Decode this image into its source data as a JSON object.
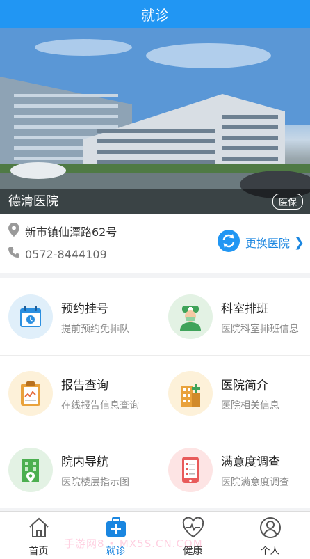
{
  "header": {
    "title": "就诊"
  },
  "hospital": {
    "name": "德清医院",
    "badge": "医保"
  },
  "info": {
    "address": "新市镇仙潭路62号",
    "phone": "0572-8444109",
    "switch_label": "更换医院"
  },
  "services": [
    {
      "title": "预约挂号",
      "subtitle": "提前预约免排队",
      "icon": "calendar-icon"
    },
    {
      "title": "科室排班",
      "subtitle": "医院科室排班信息",
      "icon": "doctor-icon"
    },
    {
      "title": "报告查询",
      "subtitle": "在线报告信息查询",
      "icon": "report-clipboard-icon"
    },
    {
      "title": "医院简介",
      "subtitle": "医院相关信息",
      "icon": "hospital-building-icon"
    },
    {
      "title": "院内导航",
      "subtitle": "医院楼层指示图",
      "icon": "map-building-icon"
    },
    {
      "title": "满意度调查",
      "subtitle": "医院满意度调查",
      "icon": "survey-phone-icon"
    }
  ],
  "tabs": [
    {
      "label": "首页",
      "icon": "home-icon"
    },
    {
      "label": "就诊",
      "icon": "medical-kit-icon",
      "active": true
    },
    {
      "label": "健康",
      "icon": "heart-pulse-icon"
    },
    {
      "label": "个人",
      "icon": "person-icon"
    }
  ],
  "watermark": "手游网8 • MX5S.CN.COM",
  "colors": {
    "primary": "#2196f3",
    "accent": "#1a86e0"
  }
}
